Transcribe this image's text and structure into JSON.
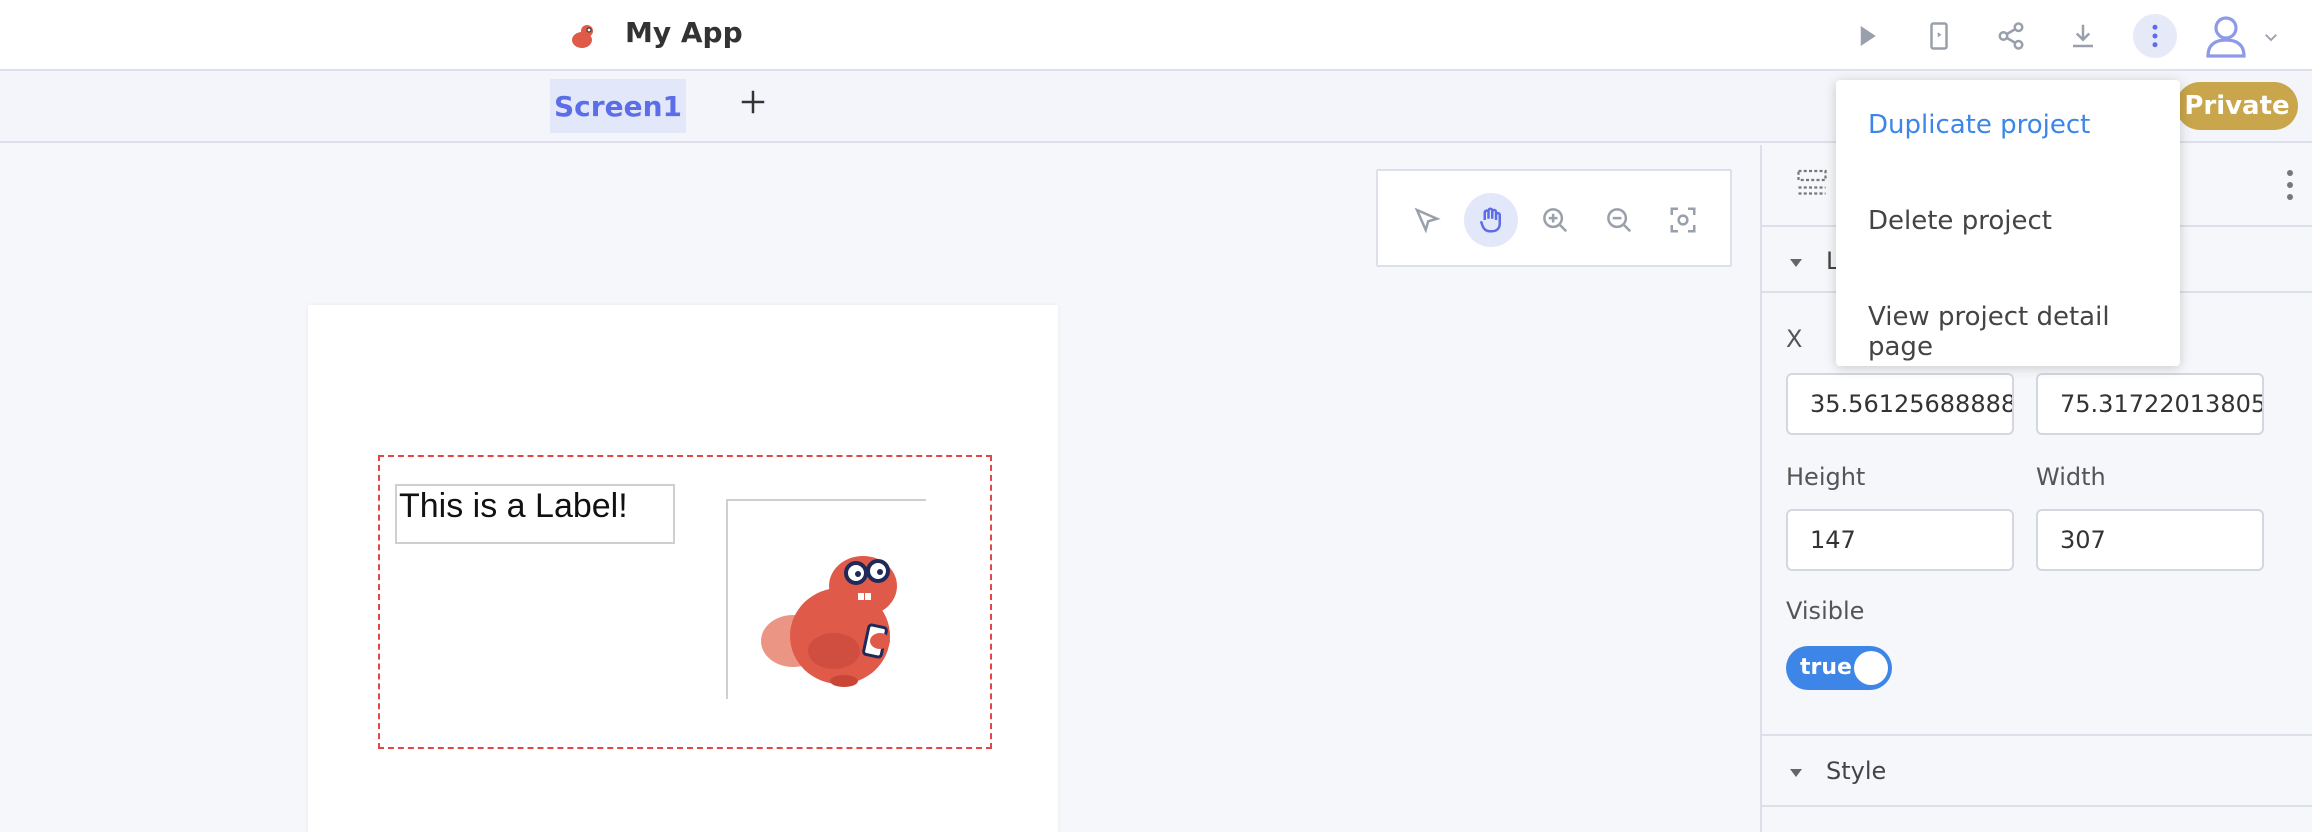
{
  "header": {
    "app_title": "My App",
    "icons": [
      "play-icon",
      "preview-device-icon",
      "share-icon",
      "download-icon",
      "more-vertical-icon",
      "user-icon",
      "chevron-down-icon"
    ]
  },
  "tabs": {
    "active_label": "Screen1",
    "add_label": "+",
    "private_label": "Private"
  },
  "menu": {
    "items": [
      "Duplicate project",
      "Delete project",
      "View project detail page"
    ]
  },
  "canvas": {
    "tools": [
      "select-pointer-icon",
      "pan-hand-icon",
      "zoom-in-icon",
      "zoom-out-icon",
      "fit-screen-icon"
    ],
    "label_text": "This is a Label!"
  },
  "panel": {
    "layout_title_partial": "L",
    "x_label": "X",
    "x_value": "35.56125688888",
    "y_value": "75.31722013805",
    "height_label": "Height",
    "height_value": "147",
    "width_label": "Width",
    "width_value": "307",
    "visible_label": "Visible",
    "visible_value": "true",
    "style_title": "Style"
  },
  "colors": {
    "accent": "#5b6ee8",
    "link_blue": "#3d86e8",
    "private_badge": "#c9a64b",
    "selection_border": "#e04848"
  }
}
